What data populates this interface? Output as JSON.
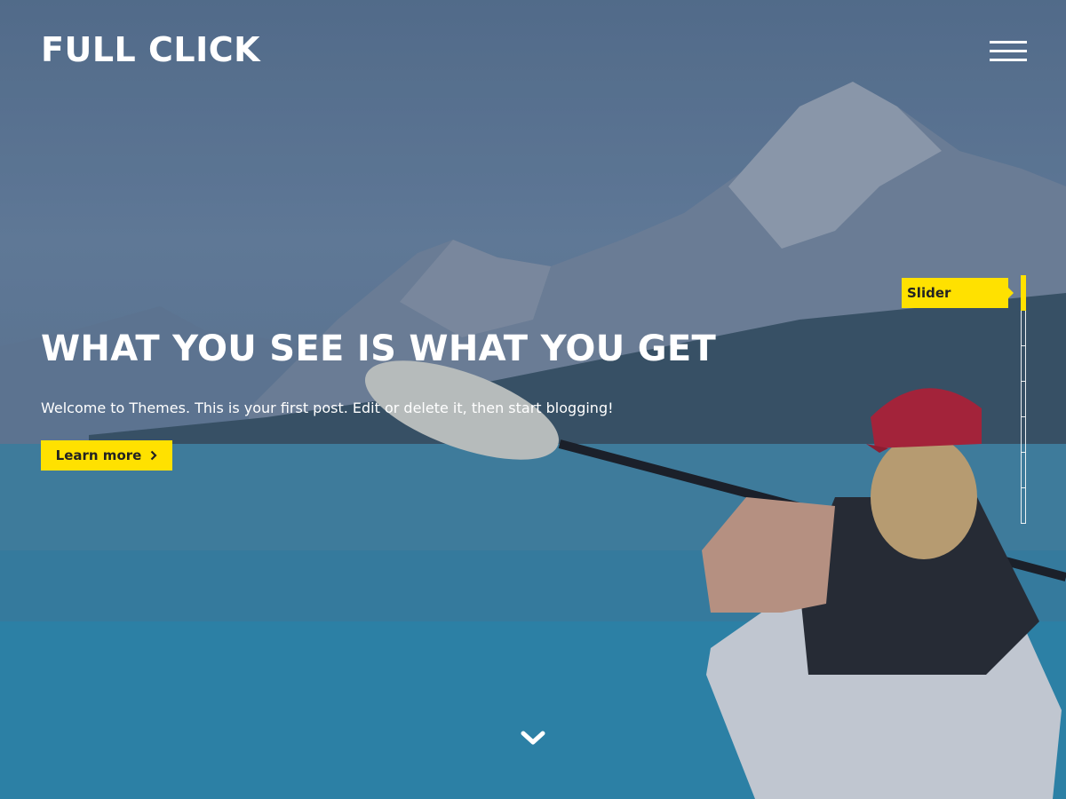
{
  "header": {
    "site_title": "FULL CLICK",
    "menu_icon": "hamburger-menu-icon"
  },
  "hero": {
    "headline": "WHAT YOU SEE IS WHAT YOU GET",
    "excerpt": "Welcome to Themes. This is your first post. Edit or delete it, then start blogging!",
    "cta_label": "Learn more",
    "cta_icon": "chevron-right-icon",
    "scroll_icon": "chevron-down-icon"
  },
  "section_nav": {
    "active_label": "Slider",
    "segments": 7,
    "active_index": 0
  },
  "colors": {
    "accent": "#ffe100",
    "text_on_image": "#ffffff"
  }
}
